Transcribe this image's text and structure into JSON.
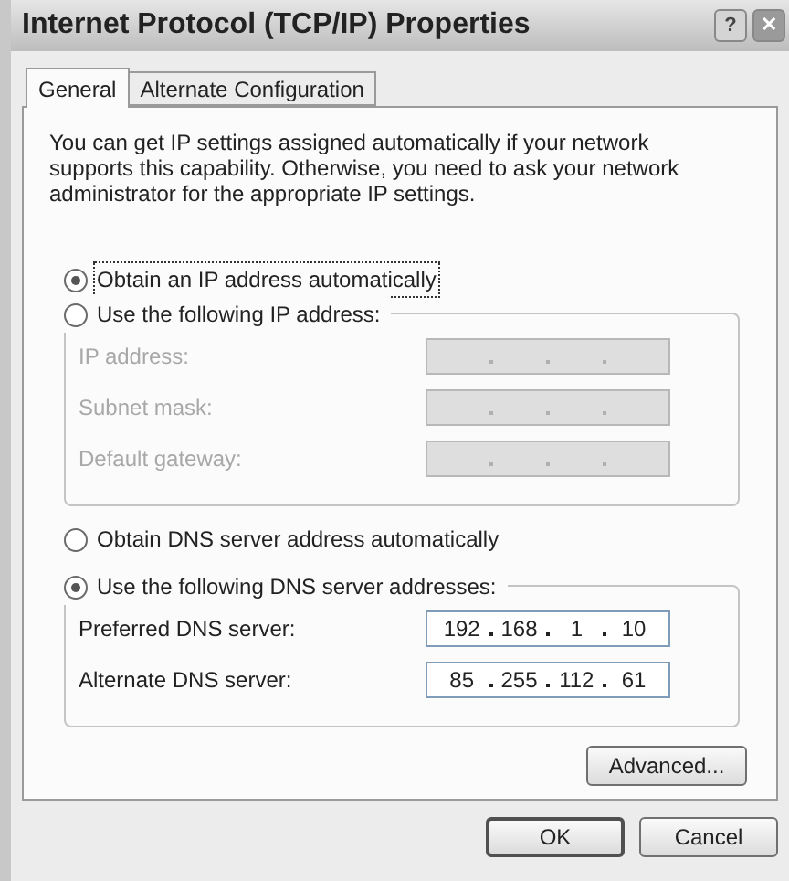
{
  "window": {
    "title": "Internet Protocol (TCP/IP) Properties",
    "buttons": [
      {
        "kind": "help",
        "label": "?"
      },
      {
        "kind": "close",
        "label": "✕"
      }
    ]
  },
  "tabs": [
    {
      "label": "General",
      "selected": true
    },
    {
      "label": "Alternate Configuration",
      "selected": false
    }
  ],
  "intro": "You can get IP settings assigned automatically if your network supports this capability. Otherwise, you need to ask your network administrator for the appropriate IP settings.",
  "ip_mode": [
    {
      "label": "Obtain an IP address automatically",
      "selected": true,
      "focused": true
    },
    {
      "label": "Use the following IP address:",
      "selected": false,
      "focused": false
    }
  ],
  "ip_fields": [
    {
      "label": "IP address:",
      "disabled": true
    },
    {
      "label": "Subnet mask:",
      "disabled": true
    },
    {
      "label": "Default gateway:",
      "disabled": true
    }
  ],
  "dns_mode": [
    {
      "label": "Obtain DNS server address automatically",
      "selected": false,
      "focused": false
    },
    {
      "label": "Use the following DNS server addresses:",
      "selected": true,
      "focused": false
    }
  ],
  "dns_fields": [
    {
      "label": "Preferred DNS server:",
      "disabled": false,
      "octets": [
        "192",
        "168",
        "1",
        "10"
      ]
    },
    {
      "label": "Alternate DNS server:",
      "disabled": false,
      "octets": [
        "85",
        "255",
        "112",
        "61"
      ]
    }
  ],
  "advanced_button": {
    "label": "Advanced..."
  },
  "footer_buttons": [
    {
      "label": "OK",
      "default": true
    },
    {
      "label": "Cancel",
      "default": false
    }
  ]
}
